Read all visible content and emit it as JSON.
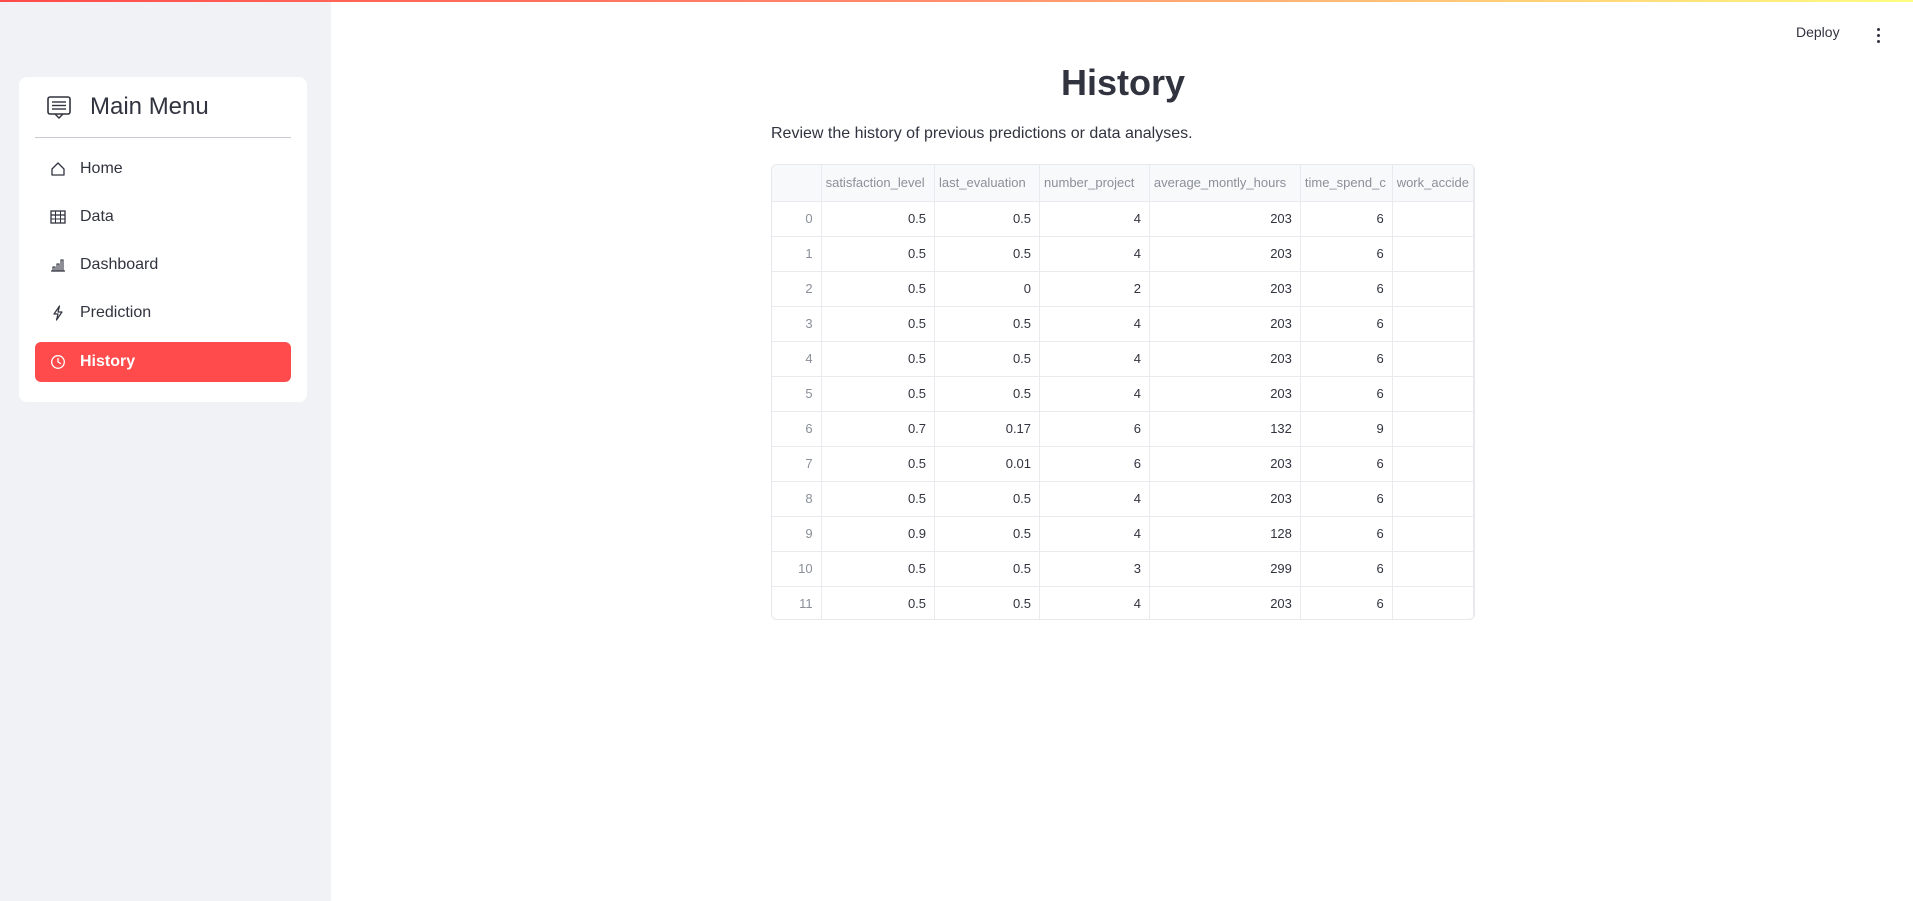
{
  "sidebar": {
    "title": "Main Menu",
    "items": [
      {
        "label": "Home",
        "icon": "house-icon"
      },
      {
        "label": "Data",
        "icon": "table-icon"
      },
      {
        "label": "Dashboard",
        "icon": "bar-chart-icon"
      },
      {
        "label": "Prediction",
        "icon": "lightning-icon"
      },
      {
        "label": "History",
        "icon": "clock-history-icon",
        "active": true
      }
    ]
  },
  "header": {
    "deploy_label": "Deploy",
    "menu_icon": "kebab-menu-icon"
  },
  "main": {
    "title": "History",
    "subtitle": "Review the history of previous predictions or data analyses.",
    "table": {
      "columns": [
        "",
        "satisfaction_level",
        "last_evaluation",
        "number_project",
        "average_montly_hours",
        "time_spend_c",
        "work_accide"
      ],
      "rows": [
        [
          "0",
          "0.5",
          "0.5",
          "4",
          "203",
          "6",
          ""
        ],
        [
          "1",
          "0.5",
          "0.5",
          "4",
          "203",
          "6",
          ""
        ],
        [
          "2",
          "0.5",
          "0",
          "2",
          "203",
          "6",
          ""
        ],
        [
          "3",
          "0.5",
          "0.5",
          "4",
          "203",
          "6",
          ""
        ],
        [
          "4",
          "0.5",
          "0.5",
          "4",
          "203",
          "6",
          ""
        ],
        [
          "5",
          "0.5",
          "0.5",
          "4",
          "203",
          "6",
          ""
        ],
        [
          "6",
          "0.7",
          "0.17",
          "6",
          "132",
          "9",
          ""
        ],
        [
          "7",
          "0.5",
          "0.01",
          "6",
          "203",
          "6",
          ""
        ],
        [
          "8",
          "0.5",
          "0.5",
          "4",
          "203",
          "6",
          ""
        ],
        [
          "9",
          "0.9",
          "0.5",
          "4",
          "128",
          "6",
          ""
        ],
        [
          "10",
          "0.5",
          "0.5",
          "3",
          "299",
          "6",
          ""
        ],
        [
          "11",
          "0.5",
          "0.5",
          "4",
          "203",
          "6",
          ""
        ]
      ]
    }
  },
  "colors": {
    "accent": "#ff4b4b",
    "sidebar_bg": "#f0f2f6",
    "text": "#31333f"
  }
}
